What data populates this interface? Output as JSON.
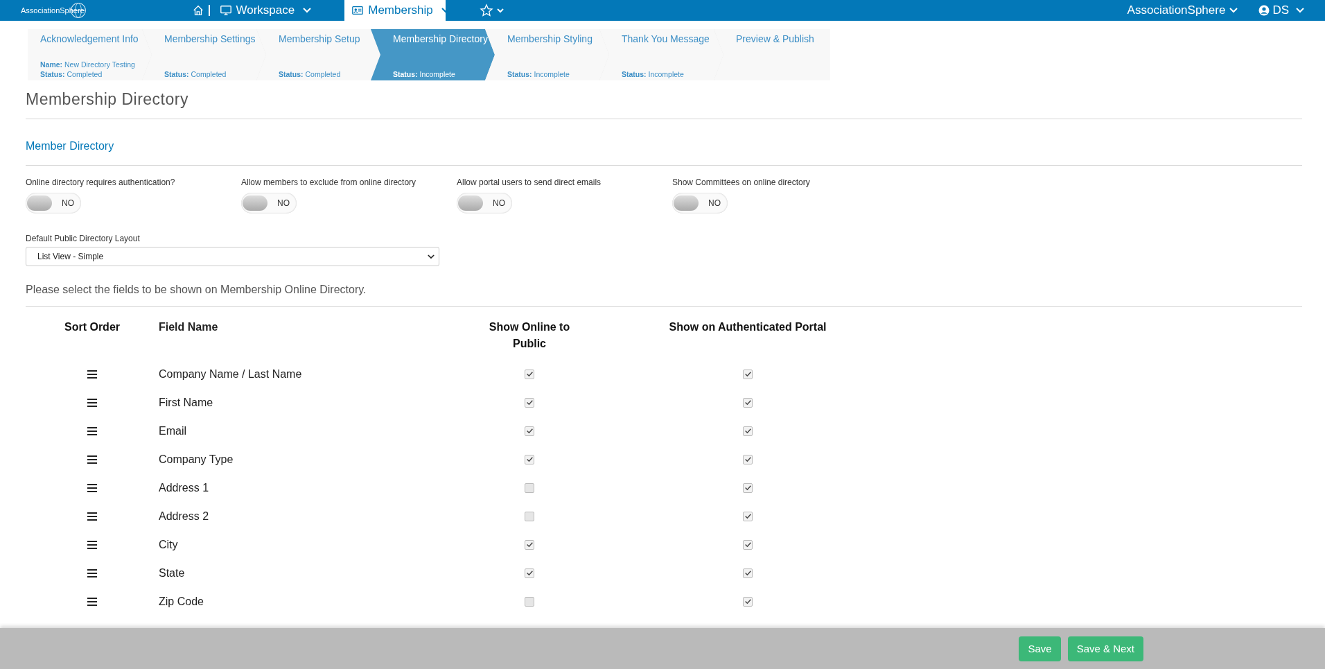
{
  "topbar": {
    "logo": "AssociationSphere",
    "nav": [
      {
        "label": "Workspace",
        "selected": false,
        "kind": "monitor"
      },
      {
        "label": "Membership",
        "selected": true,
        "kind": "card"
      }
    ],
    "org": "AssociationSphere",
    "user": "DS"
  },
  "steps": [
    {
      "title": "Acknowledgement Info",
      "name_label": "Name:",
      "name": "New Directory Testing",
      "status_label": "Status:",
      "status": "Completed",
      "selected": false
    },
    {
      "title": "Membership Settings",
      "status_label": "Status:",
      "status": "Completed",
      "selected": false
    },
    {
      "title": "Membership Setup",
      "status_label": "Status:",
      "status": "Completed",
      "selected": false
    },
    {
      "title": "Membership Directory",
      "status_label": "Status:",
      "status": "Incomplete",
      "selected": true
    },
    {
      "title": "Membership Styling",
      "status_label": "Status:",
      "status": "Incomplete",
      "selected": false
    },
    {
      "title": "Thank You Message",
      "status_label": "Status:",
      "status": "Incomplete",
      "selected": false
    },
    {
      "title": "Preview & Publish",
      "selected": false
    }
  ],
  "page_title": "Membership Directory",
  "section_title": "Member Directory",
  "toggles": [
    {
      "label": "Online directory requires authentication?",
      "on": false,
      "text": "NO"
    },
    {
      "label": "Allow members to exclude from online directory",
      "on": false,
      "text": "NO"
    },
    {
      "label": "Allow portal users to send direct emails",
      "on": false,
      "text": "NO"
    },
    {
      "label": "Show Committees on online directory",
      "on": false,
      "text": "NO"
    }
  ],
  "layout_select": {
    "label": "Default Public Directory Layout",
    "value": "List View - Simple"
  },
  "instructions": "Please select the fields to be shown on Membership Online Directory.",
  "table": {
    "columns": [
      "Sort Order",
      "Field Name",
      "Show Online to Public",
      "Show on Authenticated Portal"
    ],
    "rows": [
      {
        "field": "Company Name / Last Name",
        "public": true,
        "portal": true
      },
      {
        "field": "First Name",
        "public": true,
        "portal": true
      },
      {
        "field": "Email",
        "public": true,
        "portal": true
      },
      {
        "field": "Company Type",
        "public": true,
        "portal": true
      },
      {
        "field": "Address 1",
        "public": false,
        "portal": true
      },
      {
        "field": "Address 2",
        "public": false,
        "portal": true
      },
      {
        "field": "City",
        "public": true,
        "portal": true
      },
      {
        "field": "State",
        "public": true,
        "portal": true
      },
      {
        "field": "Zip Code",
        "public": false,
        "portal": true
      }
    ]
  },
  "footer": {
    "buttons": [
      "Save",
      "Save & Next"
    ]
  }
}
